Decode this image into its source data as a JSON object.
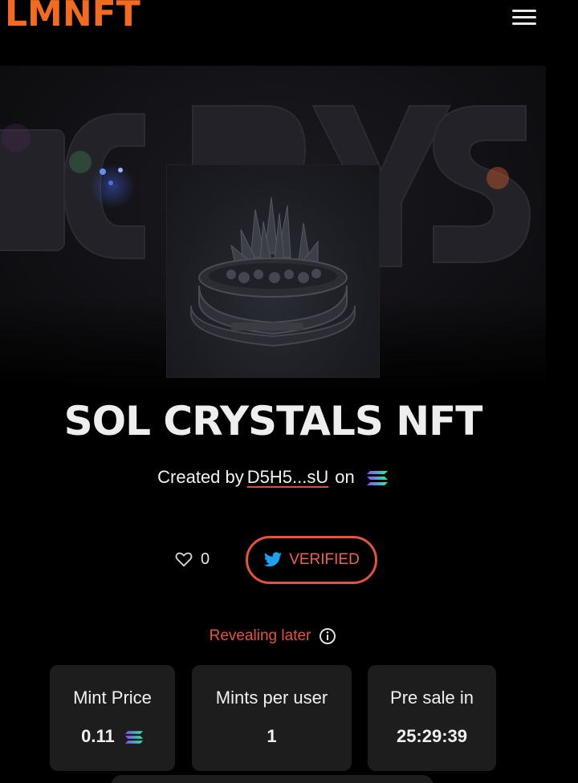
{
  "header": {
    "logo": "LMNFT",
    "menu_icon": "hamburger-icon"
  },
  "collection": {
    "title": "SOL CRYSTALS NFT",
    "created_by_label": "Created by",
    "creator_address": "D5H5...sU",
    "on_label": "on",
    "chain_icon": "solana-icon",
    "likes": "0",
    "verified_label": "VERIFIED",
    "reveal_text": "Revealing later"
  },
  "stats": [
    {
      "label": "Mint Price",
      "value": "0.11"
    },
    {
      "label": "Mints per user",
      "value": "1"
    },
    {
      "label": "Pre sale in",
      "value": "25:29:39"
    }
  ],
  "colors": {
    "brand": "#f36a21",
    "accent": "#e5533b",
    "twitter": "#1da1f2"
  }
}
